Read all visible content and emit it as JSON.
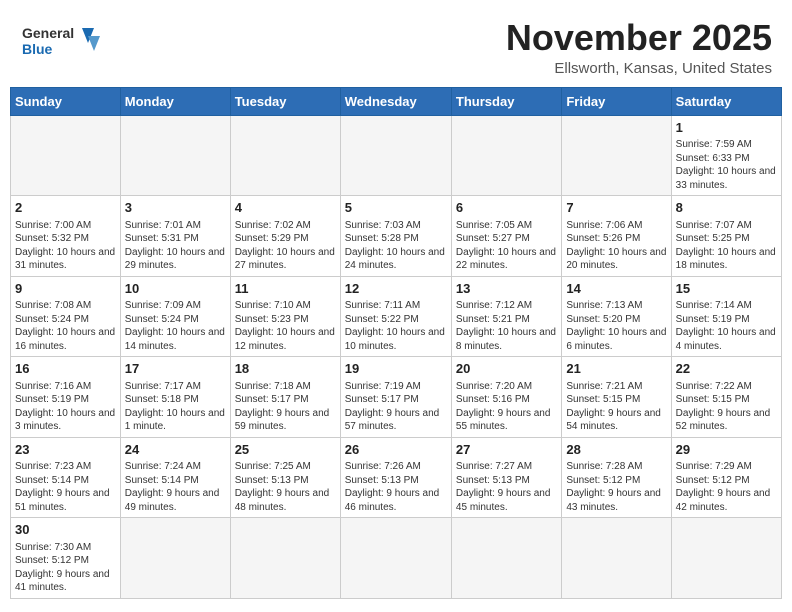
{
  "header": {
    "logo_general": "General",
    "logo_blue": "Blue",
    "month_title": "November 2025",
    "location": "Ellsworth, Kansas, United States"
  },
  "days_of_week": [
    "Sunday",
    "Monday",
    "Tuesday",
    "Wednesday",
    "Thursday",
    "Friday",
    "Saturday"
  ],
  "weeks": [
    [
      {
        "day": "",
        "info": ""
      },
      {
        "day": "",
        "info": ""
      },
      {
        "day": "",
        "info": ""
      },
      {
        "day": "",
        "info": ""
      },
      {
        "day": "",
        "info": ""
      },
      {
        "day": "",
        "info": ""
      },
      {
        "day": "1",
        "info": "Sunrise: 7:59 AM\nSunset: 6:33 PM\nDaylight: 10 hours\nand 33 minutes."
      }
    ],
    [
      {
        "day": "2",
        "info": "Sunrise: 7:00 AM\nSunset: 5:32 PM\nDaylight: 10 hours\nand 31 minutes."
      },
      {
        "day": "3",
        "info": "Sunrise: 7:01 AM\nSunset: 5:31 PM\nDaylight: 10 hours\nand 29 minutes."
      },
      {
        "day": "4",
        "info": "Sunrise: 7:02 AM\nSunset: 5:29 PM\nDaylight: 10 hours\nand 27 minutes."
      },
      {
        "day": "5",
        "info": "Sunrise: 7:03 AM\nSunset: 5:28 PM\nDaylight: 10 hours\nand 24 minutes."
      },
      {
        "day": "6",
        "info": "Sunrise: 7:05 AM\nSunset: 5:27 PM\nDaylight: 10 hours\nand 22 minutes."
      },
      {
        "day": "7",
        "info": "Sunrise: 7:06 AM\nSunset: 5:26 PM\nDaylight: 10 hours\nand 20 minutes."
      },
      {
        "day": "8",
        "info": "Sunrise: 7:07 AM\nSunset: 5:25 PM\nDaylight: 10 hours\nand 18 minutes."
      }
    ],
    [
      {
        "day": "9",
        "info": "Sunrise: 7:08 AM\nSunset: 5:24 PM\nDaylight: 10 hours\nand 16 minutes."
      },
      {
        "day": "10",
        "info": "Sunrise: 7:09 AM\nSunset: 5:24 PM\nDaylight: 10 hours\nand 14 minutes."
      },
      {
        "day": "11",
        "info": "Sunrise: 7:10 AM\nSunset: 5:23 PM\nDaylight: 10 hours\nand 12 minutes."
      },
      {
        "day": "12",
        "info": "Sunrise: 7:11 AM\nSunset: 5:22 PM\nDaylight: 10 hours\nand 10 minutes."
      },
      {
        "day": "13",
        "info": "Sunrise: 7:12 AM\nSunset: 5:21 PM\nDaylight: 10 hours\nand 8 minutes."
      },
      {
        "day": "14",
        "info": "Sunrise: 7:13 AM\nSunset: 5:20 PM\nDaylight: 10 hours\nand 6 minutes."
      },
      {
        "day": "15",
        "info": "Sunrise: 7:14 AM\nSunset: 5:19 PM\nDaylight: 10 hours\nand 4 minutes."
      }
    ],
    [
      {
        "day": "16",
        "info": "Sunrise: 7:16 AM\nSunset: 5:19 PM\nDaylight: 10 hours\nand 3 minutes."
      },
      {
        "day": "17",
        "info": "Sunrise: 7:17 AM\nSunset: 5:18 PM\nDaylight: 10 hours\nand 1 minute."
      },
      {
        "day": "18",
        "info": "Sunrise: 7:18 AM\nSunset: 5:17 PM\nDaylight: 9 hours\nand 59 minutes."
      },
      {
        "day": "19",
        "info": "Sunrise: 7:19 AM\nSunset: 5:17 PM\nDaylight: 9 hours\nand 57 minutes."
      },
      {
        "day": "20",
        "info": "Sunrise: 7:20 AM\nSunset: 5:16 PM\nDaylight: 9 hours\nand 55 minutes."
      },
      {
        "day": "21",
        "info": "Sunrise: 7:21 AM\nSunset: 5:15 PM\nDaylight: 9 hours\nand 54 minutes."
      },
      {
        "day": "22",
        "info": "Sunrise: 7:22 AM\nSunset: 5:15 PM\nDaylight: 9 hours\nand 52 minutes."
      }
    ],
    [
      {
        "day": "23",
        "info": "Sunrise: 7:23 AM\nSunset: 5:14 PM\nDaylight: 9 hours\nand 51 minutes."
      },
      {
        "day": "24",
        "info": "Sunrise: 7:24 AM\nSunset: 5:14 PM\nDaylight: 9 hours\nand 49 minutes."
      },
      {
        "day": "25",
        "info": "Sunrise: 7:25 AM\nSunset: 5:13 PM\nDaylight: 9 hours\nand 48 minutes."
      },
      {
        "day": "26",
        "info": "Sunrise: 7:26 AM\nSunset: 5:13 PM\nDaylight: 9 hours\nand 46 minutes."
      },
      {
        "day": "27",
        "info": "Sunrise: 7:27 AM\nSunset: 5:13 PM\nDaylight: 9 hours\nand 45 minutes."
      },
      {
        "day": "28",
        "info": "Sunrise: 7:28 AM\nSunset: 5:12 PM\nDaylight: 9 hours\nand 43 minutes."
      },
      {
        "day": "29",
        "info": "Sunrise: 7:29 AM\nSunset: 5:12 PM\nDaylight: 9 hours\nand 42 minutes."
      }
    ],
    [
      {
        "day": "30",
        "info": "Sunrise: 7:30 AM\nSunset: 5:12 PM\nDaylight: 9 hours\nand 41 minutes."
      },
      {
        "day": "",
        "info": ""
      },
      {
        "day": "",
        "info": ""
      },
      {
        "day": "",
        "info": ""
      },
      {
        "day": "",
        "info": ""
      },
      {
        "day": "",
        "info": ""
      },
      {
        "day": "",
        "info": ""
      }
    ]
  ]
}
